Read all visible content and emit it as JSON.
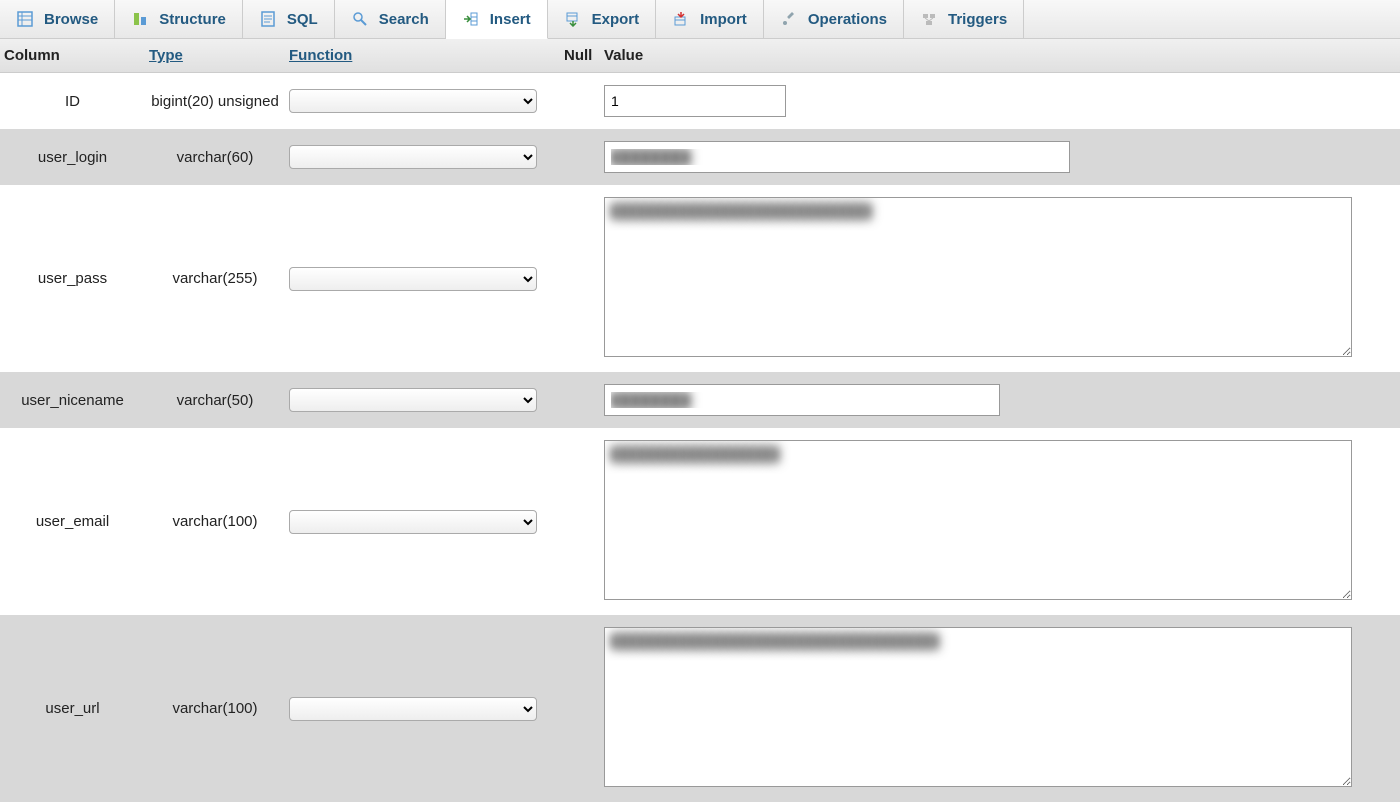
{
  "tabs": [
    {
      "label": "Browse",
      "icon": "browse-icon"
    },
    {
      "label": "Structure",
      "icon": "structure-icon"
    },
    {
      "label": "SQL",
      "icon": "sql-icon"
    },
    {
      "label": "Search",
      "icon": "search-icon"
    },
    {
      "label": "Insert",
      "icon": "insert-icon",
      "active": true
    },
    {
      "label": "Export",
      "icon": "export-icon"
    },
    {
      "label": "Import",
      "icon": "import-icon"
    },
    {
      "label": "Operations",
      "icon": "operations-icon"
    },
    {
      "label": "Triggers",
      "icon": "triggers-icon"
    }
  ],
  "headers": {
    "column": "Column",
    "type": "Type",
    "function": "Function",
    "null": "Null",
    "value": "Value"
  },
  "rows": [
    {
      "column": "ID",
      "type": "bigint(20) unsigned",
      "valueType": "input",
      "value": "1",
      "valueWidth": "182px"
    },
    {
      "column": "user_login",
      "type": "varchar(60)",
      "valueType": "input",
      "value": "████████",
      "valueWidth": "466px",
      "blurred": true
    },
    {
      "column": "user_pass",
      "type": "varchar(255)",
      "valueType": "textarea",
      "value": "███████████████████████████████",
      "rows": 8,
      "valueWidth": "748px",
      "blurred": true
    },
    {
      "column": "user_nicename",
      "type": "varchar(50)",
      "valueType": "input",
      "value": "████████",
      "valueWidth": "396px",
      "blurred": true
    },
    {
      "column": "user_email",
      "type": "varchar(100)",
      "valueType": "textarea",
      "value": "████████████████████",
      "rows": 8,
      "valueWidth": "748px",
      "blurred": true
    },
    {
      "column": "user_url",
      "type": "varchar(100)",
      "valueType": "textarea",
      "value": "███████████████████████████████████████",
      "rows": 8,
      "valueWidth": "748px",
      "blurred": true
    }
  ]
}
